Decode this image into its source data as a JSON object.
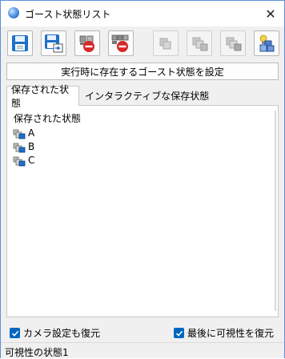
{
  "window": {
    "title": "ゴースト状態リスト"
  },
  "toolbar": {
    "buttons": [
      {
        "icon": "save-icon",
        "enabled": true
      },
      {
        "icon": "save-as-icon",
        "enabled": true
      },
      {
        "icon": "delete-icon",
        "enabled": true
      },
      {
        "icon": "delete-all-icon",
        "enabled": true
      },
      {
        "icon": "state-icon",
        "enabled": false
      },
      {
        "icon": "state-add-icon",
        "enabled": false
      },
      {
        "icon": "state-remove-icon",
        "enabled": false
      },
      {
        "icon": "state-lights-icon",
        "enabled": true
      }
    ]
  },
  "set_button": {
    "label": "実行時に存在するゴースト状態を設定"
  },
  "tabs": [
    {
      "label": "保存された状態",
      "active": true
    },
    {
      "label": "インタラクティブな保存状態",
      "active": false
    }
  ],
  "list": {
    "heading": "保存された状態",
    "items": [
      {
        "label": "A"
      },
      {
        "label": "B"
      },
      {
        "label": "C"
      }
    ]
  },
  "options": {
    "restore_camera": {
      "label": "カメラ設定も復元",
      "checked": true
    },
    "restore_visibility_last": {
      "label": "最後に可視性を復元",
      "checked": true
    }
  },
  "status": {
    "text": "可視性の状態1"
  },
  "colors": {
    "accent": "#0067c0",
    "window_border": "#5d8fd6",
    "save_blue": "#1f6fc9",
    "delete_red": "#d62828"
  }
}
